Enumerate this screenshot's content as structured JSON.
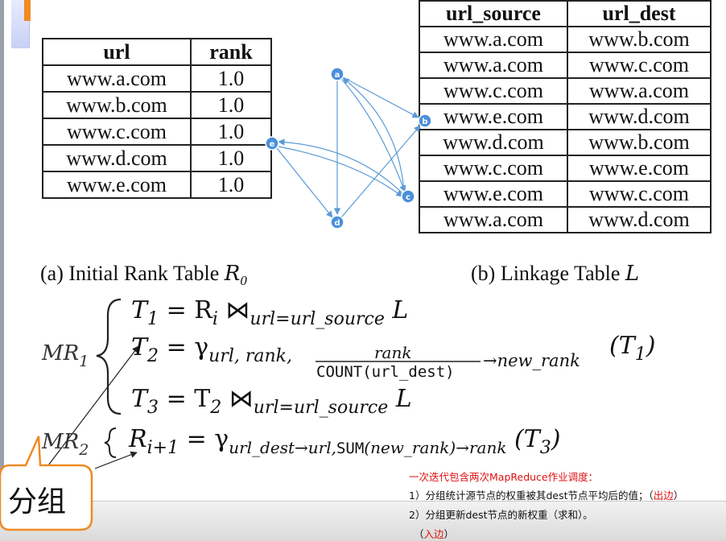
{
  "rank_table": {
    "headers": [
      "url",
      "rank"
    ],
    "rows": [
      [
        "www.a.com",
        "1.0"
      ],
      [
        "www.b.com",
        "1.0"
      ],
      [
        "www.c.com",
        "1.0"
      ],
      [
        "www.d.com",
        "1.0"
      ],
      [
        "www.e.com",
        "1.0"
      ]
    ]
  },
  "link_table": {
    "headers": [
      "url_source",
      "url_dest"
    ],
    "rows": [
      [
        "www.a.com",
        "www.b.com"
      ],
      [
        "www.a.com",
        "www.c.com"
      ],
      [
        "www.c.com",
        "www.a.com"
      ],
      [
        "www.e.com",
        "www.d.com"
      ],
      [
        "www.d.com",
        "www.b.com"
      ],
      [
        "www.c.com",
        "www.e.com"
      ],
      [
        "www.e.com",
        "www.c.com"
      ],
      [
        "www.a.com",
        "www.d.com"
      ]
    ]
  },
  "graph": {
    "nodes": [
      "a",
      "b",
      "c",
      "d",
      "e"
    ],
    "edge_color": "#5b9bd5"
  },
  "captions": {
    "a_text": "(a) Initial Rank Table ",
    "a_math": "R",
    "a_sub": "0",
    "b_text": "(b) Linkage Table ",
    "b_math": "L"
  },
  "formulas": {
    "mr1": "MR",
    "mr1_sub": "1",
    "mr2": "MR",
    "mr2_sub": "2",
    "t1_lhs": "T",
    "t1_lhs_sub": "1",
    "t1_rhs": "= R",
    "t1_rhs_sub": "i",
    "t1_join": "⋈",
    "t1_join_sub": "url=url_source",
    "t1_tail": "L",
    "t2_lhs": "T",
    "t2_lhs_sub": "2",
    "t2_gamma": "= γ",
    "t2_gamma_sub": "url, rank,",
    "t2_frac_num": "rank",
    "t2_frac_den": "COUNT(url_dest)",
    "t2_arrow": "→new_rank",
    "t2_tail": "(T",
    "t2_tail_sub": "1",
    "t2_tail_close": ")",
    "t3_lhs": "T",
    "t3_lhs_sub": "3",
    "t3_rhs": "= T",
    "t3_rhs_sub": "2",
    "t3_join": "⋈",
    "t3_join_sub": "url=url_source",
    "t3_tail": "L",
    "r_lhs": "R",
    "r_lhs_sub": "i+1",
    "r_gamma": "= γ",
    "r_gamma_sub": "url_dest→url,",
    "r_sum": "SUM",
    "r_sum_rest": "(new_rank)→rank",
    "r_tail": "(T",
    "r_tail_sub": "3",
    "r_tail_close": ")"
  },
  "notes": {
    "line1": "一次迭代包含两次MapReduce作业调度：",
    "line2_text": "1）分组统计源节点的权重被其dest节点平均后的值；（",
    "line2_red": "出边",
    "line2_close": "）",
    "line3": "2）分组更新dest节点的新权重（求和）。",
    "line4_open": "（",
    "line4_red": "入边",
    "line4_close": "）"
  },
  "callout": {
    "label": "分组",
    "border_color": "#f08a24"
  }
}
